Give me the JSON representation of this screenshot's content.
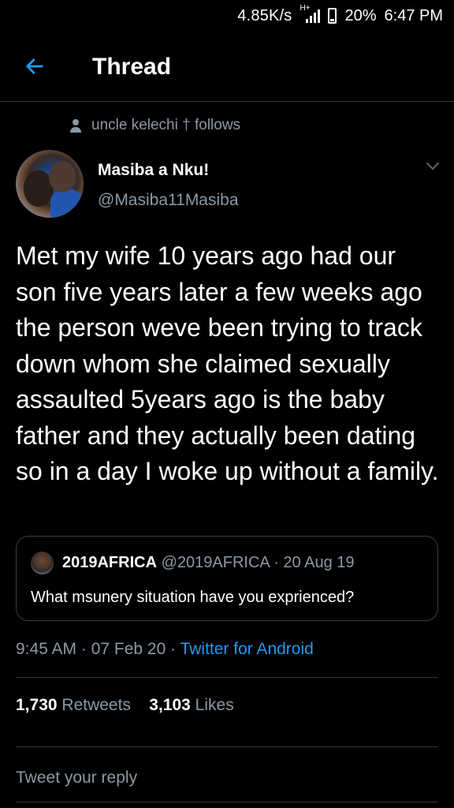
{
  "status_bar": {
    "net_speed": "4.85K/s",
    "network_type": "H+",
    "battery": "20%",
    "time": "6:47 PM"
  },
  "header": {
    "back_icon": "arrow-left-icon",
    "title": "Thread"
  },
  "social_context": {
    "icon": "person-icon",
    "text": "uncle kelechi † follows"
  },
  "tweet": {
    "author_name": "Masiba a Nku!",
    "author_handle": "@Masiba11Masiba",
    "text": "Met my wife 10 years ago had our son five years later a few weeks ago the person weve been trying to track down whom she claimed sexually assaulted 5years ago is the baby father and they actually been dating so in a day I woke up without a family.",
    "quoted": {
      "name": "2019AFRICA",
      "meta": " @2019AFRICA · 20 Aug 19",
      "text": "What msunery situation have you exprienced?"
    },
    "time": "9:45 AM · 07 Feb 20 · ",
    "source": "Twitter for Android",
    "retweets_count": "1,730",
    "retweets_label": " Retweets",
    "likes_count": "3,103",
    "likes_label": " Likes"
  },
  "reply": {
    "placeholder": "Tweet your reply"
  },
  "colors": {
    "background": "#000000",
    "accent": "#1d9bf0",
    "secondary_text": "#8b98a5",
    "divider": "#2f3336"
  }
}
